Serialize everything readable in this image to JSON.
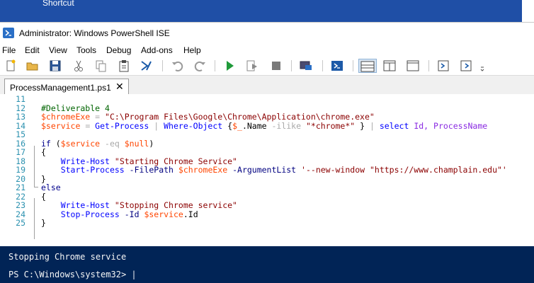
{
  "desktop": {
    "label": "Shortcut"
  },
  "window": {
    "title": "Administrator: Windows PowerShell ISE"
  },
  "menu": [
    "File",
    "Edit",
    "View",
    "Tools",
    "Debug",
    "Add-ons",
    "Help"
  ],
  "toolbar": {
    "icons": [
      "new-icon",
      "open-icon",
      "save-icon",
      "cut-icon",
      "copy-icon",
      "paste-icon",
      "clear-console-icon",
      "undo-icon",
      "redo-icon",
      "run-icon",
      "run-selection-icon",
      "stop-icon",
      "remote-powershell-icon",
      "powershell-icon",
      "layout-top-icon",
      "layout-right-icon",
      "layout-max-icon",
      "show-script-pane-icon",
      "show-commands-icon",
      "toolbar-overflow-icon"
    ]
  },
  "tab": {
    "label": "ProcessManagement1.ps1",
    "close": "✕"
  },
  "editor": {
    "line_numbers": [
      "11",
      "12",
      "13",
      "14",
      "15",
      "16",
      "17",
      "18",
      "19",
      "20",
      "21",
      "22",
      "23",
      "24",
      "25"
    ],
    "lines": [
      {
        "tokens": []
      },
      {
        "tokens": [
          {
            "t": "#Deliverable 4",
            "k": "comment"
          }
        ]
      },
      {
        "tokens": [
          {
            "t": "$chromeExe",
            "k": "var"
          },
          {
            "t": " = ",
            "k": "op"
          },
          {
            "t": "\"C:\\Program Files\\Google\\Chrome\\Application\\chrome.exe\"",
            "k": "str"
          }
        ]
      },
      {
        "tokens": [
          {
            "t": "$service",
            "k": "var"
          },
          {
            "t": " = ",
            "k": "op"
          },
          {
            "t": "Get-Process",
            "k": "cmd"
          },
          {
            "t": " | ",
            "k": "op"
          },
          {
            "t": "Where-Object",
            "k": "cmd"
          },
          {
            "t": " {",
            "k": "group"
          },
          {
            "t": "$_",
            "k": "var"
          },
          {
            "t": ".Name ",
            "k": "member"
          },
          {
            "t": "-ilike",
            "k": "op"
          },
          {
            "t": " ",
            "k": "plain"
          },
          {
            "t": "\"*chrome*\"",
            "k": "str"
          },
          {
            "t": " }",
            "k": "group"
          },
          {
            "t": " | ",
            "k": "op"
          },
          {
            "t": "select",
            "k": "cmd"
          },
          {
            "t": " Id, ProcessName",
            "k": "arg"
          }
        ]
      },
      {
        "tokens": []
      },
      {
        "tokens": [
          {
            "t": "if",
            "k": "kw"
          },
          {
            "t": " (",
            "k": "group"
          },
          {
            "t": "$service",
            "k": "var"
          },
          {
            "t": " -eq ",
            "k": "op"
          },
          {
            "t": "$null",
            "k": "var"
          },
          {
            "t": ")",
            "k": "group"
          }
        ]
      },
      {
        "tokens": [
          {
            "t": "{",
            "k": "group"
          }
        ]
      },
      {
        "tokens": [
          {
            "t": "    ",
            "k": "plain"
          },
          {
            "t": "Write-Host",
            "k": "cmd"
          },
          {
            "t": " ",
            "k": "plain"
          },
          {
            "t": "\"Starting Chrome Service\"",
            "k": "str"
          }
        ]
      },
      {
        "tokens": [
          {
            "t": "    ",
            "k": "plain"
          },
          {
            "t": "Start-Process",
            "k": "cmd"
          },
          {
            "t": " ",
            "k": "plain"
          },
          {
            "t": "-FilePath",
            "k": "param"
          },
          {
            "t": " ",
            "k": "plain"
          },
          {
            "t": "$chromeExe",
            "k": "var"
          },
          {
            "t": " ",
            "k": "plain"
          },
          {
            "t": "-ArgumentList",
            "k": "param"
          },
          {
            "t": " ",
            "k": "plain"
          },
          {
            "t": "'--new-window \"https://www.champlain.edu\"'",
            "k": "str"
          }
        ]
      },
      {
        "tokens": [
          {
            "t": "}",
            "k": "group"
          }
        ]
      },
      {
        "tokens": [
          {
            "t": "else",
            "k": "kw"
          }
        ]
      },
      {
        "tokens": [
          {
            "t": "{",
            "k": "group"
          }
        ]
      },
      {
        "tokens": [
          {
            "t": "    ",
            "k": "plain"
          },
          {
            "t": "Write-Host",
            "k": "cmd"
          },
          {
            "t": " ",
            "k": "plain"
          },
          {
            "t": "\"Stopping Chrome service\"",
            "k": "str"
          }
        ]
      },
      {
        "tokens": [
          {
            "t": "    ",
            "k": "plain"
          },
          {
            "t": "Stop-Process",
            "k": "cmd"
          },
          {
            "t": " ",
            "k": "plain"
          },
          {
            "t": "-Id",
            "k": "param"
          },
          {
            "t": " ",
            "k": "plain"
          },
          {
            "t": "$service",
            "k": "var"
          },
          {
            "t": ".Id",
            "k": "member"
          }
        ]
      },
      {
        "tokens": [
          {
            "t": "}",
            "k": "group"
          }
        ]
      }
    ]
  },
  "console": {
    "output": "Stopping Chrome service",
    "prompt": "PS C:\\Windows\\system32> |"
  },
  "colors": {
    "desktop_blue": "#1f4fa6",
    "console_bg": "#012456",
    "console_fg": "#f5f5f5",
    "line_number": "#2b91af",
    "comment": "#006400",
    "variable": "#ff4500",
    "operator": "#a9a9a9",
    "string": "#8b0000",
    "command": "#0000ff",
    "keyword": "#00008b",
    "parameter": "#000080",
    "command_argument": "#8a2be2"
  }
}
